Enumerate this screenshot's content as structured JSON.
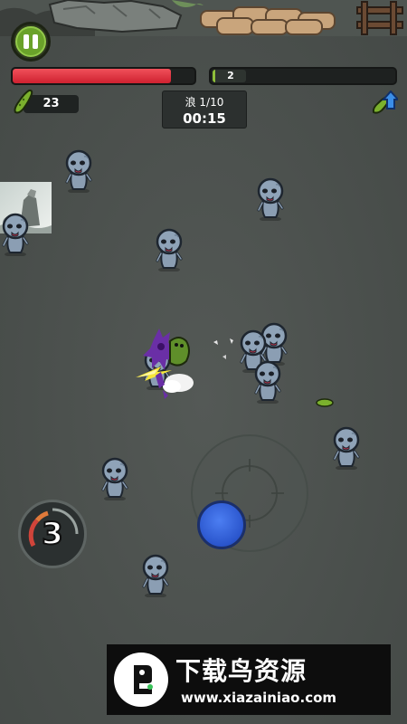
{
  "hud": {
    "health_fraction": 0.87,
    "xp_level": "2",
    "xp_fraction": 0.0,
    "pickle_count": "23",
    "wave_label": "浪 1/10",
    "timer": "00:15",
    "skill_charges": "3"
  },
  "icons": {
    "pause": "pause-icon",
    "pickle": "pickle-icon",
    "upgrade": "upgrade-arrow-icon",
    "joystick": "joystick-crosshair-icon"
  },
  "watermark": {
    "title": "下载鸟资源",
    "url": "www.xiazainiao.com"
  },
  "colors": {
    "health": "#e0323d",
    "joystick_knob": "#3a66e0",
    "pause_button": "#6aa22a",
    "ground": "#4b504d"
  }
}
